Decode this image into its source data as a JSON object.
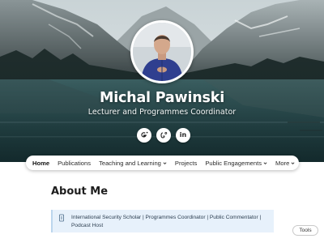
{
  "profile": {
    "name": "Michal Pawinski",
    "subtitle": "Lecturer and Programmes Coordinator"
  },
  "social_links": [
    {
      "icon": "google-scholar-icon"
    },
    {
      "icon": "researchgate-icon"
    },
    {
      "icon": "linkedin-icon",
      "label": "in"
    }
  ],
  "nav": {
    "items": [
      {
        "label": "Home",
        "active": true
      },
      {
        "label": "Publications"
      },
      {
        "label": "Teaching and Learning",
        "dropdown": true
      },
      {
        "label": "Projects"
      },
      {
        "label": "Public Engagements",
        "dropdown": true
      },
      {
        "label": "More",
        "dropdown": true
      }
    ]
  },
  "about": {
    "title": "About Me",
    "callout_icon": "info-icon",
    "callout_text": "International Security Scholar | Programmes Coordinator | Public Commentator | Podcast Host"
  },
  "tools_label": "Tools",
  "colors": {
    "callout_bg": "#e7f1fb",
    "text": "#1d1d1d",
    "hero_water": "#2f4f50"
  }
}
